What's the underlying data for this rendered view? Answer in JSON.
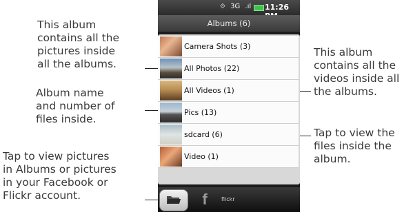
{
  "status_bar": {
    "sound_icon": "⟐",
    "network": "3G",
    "signal": ".ıl",
    "time": "11:26 PM"
  },
  "header": {
    "title": "Albums (6)"
  },
  "albums": [
    {
      "label": "Camera Shots (3)",
      "thumb": "camera"
    },
    {
      "label": "All Photos (22)",
      "thumb": "photos"
    },
    {
      "label": "All Videos (1)",
      "thumb": "videos"
    },
    {
      "label": "Pics (13)",
      "thumb": "pics"
    },
    {
      "label": "sdcard (6)",
      "thumb": "sdcard"
    },
    {
      "label": "Video (1)",
      "thumb": "video"
    }
  ],
  "bottom_bar": {
    "facebook_label": "f",
    "flickr_label": "flickr"
  },
  "annotations": {
    "top_left": [
      "This album",
      "contains all the",
      "pictures inside",
      "all the albums."
    ],
    "mid_left": [
      "Album name",
      "and number of",
      "files inside."
    ],
    "bottom_left": [
      "Tap to view pictures",
      "in Albums or pictures",
      "in your Facebook or",
      "Flickr account."
    ],
    "top_right": [
      "This album",
      "contains all the",
      "videos inside all",
      "the albums."
    ],
    "bottom_right": [
      "Tap to view the",
      "files inside the",
      "album."
    ]
  }
}
